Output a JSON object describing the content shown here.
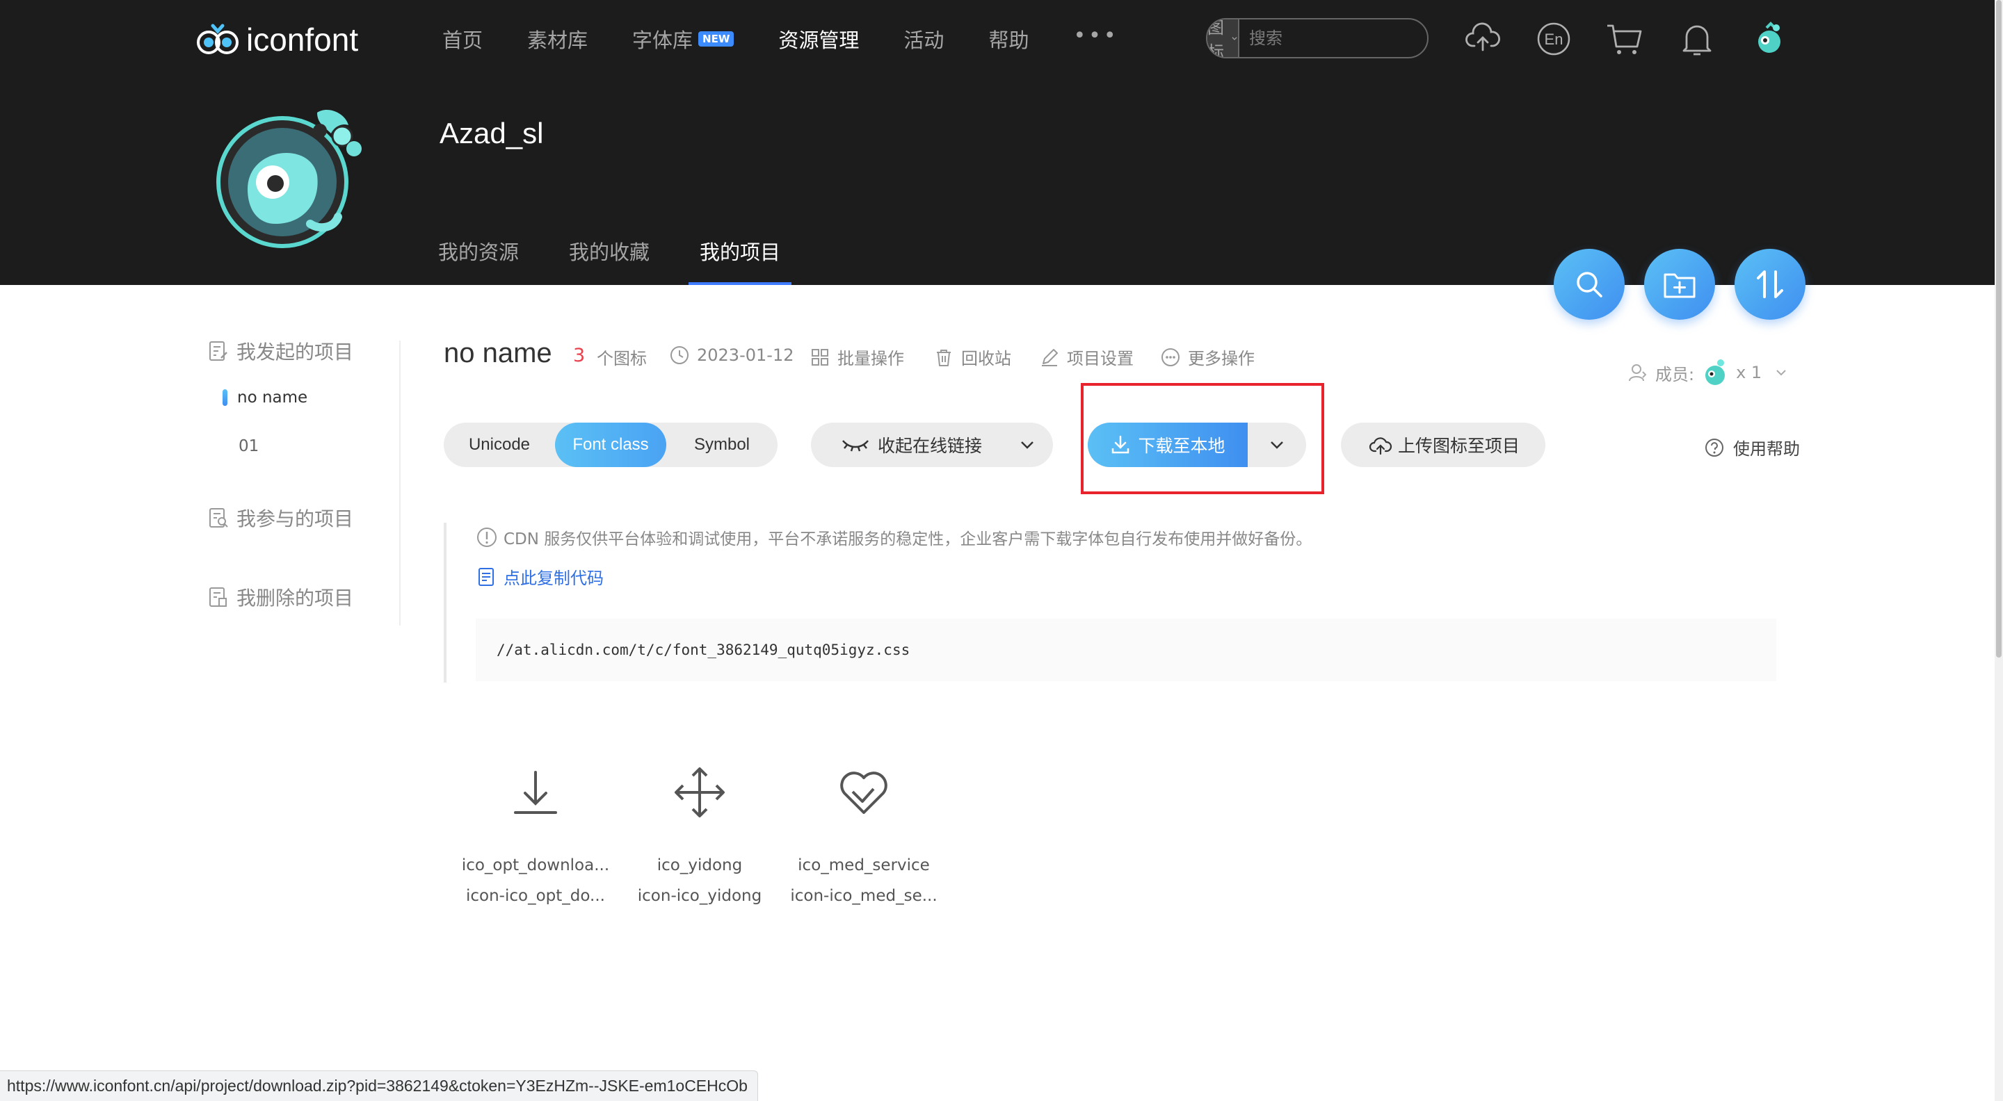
{
  "header": {
    "logo_text": "iconfont",
    "nav": [
      {
        "label": "首页"
      },
      {
        "label": "素材库"
      },
      {
        "label": "字体库",
        "badge": "NEW"
      },
      {
        "label": "资源管理",
        "active": true
      },
      {
        "label": "活动"
      },
      {
        "label": "帮助"
      }
    ],
    "more": "•••",
    "search": {
      "type": "图标",
      "placeholder": "搜索"
    },
    "icons": [
      "upload-cloud-icon",
      "language-en-icon",
      "cart-icon",
      "bell-icon",
      "user-avatar"
    ],
    "lang_label": "En"
  },
  "profile": {
    "username": "Azad_sl",
    "tabs": [
      {
        "label": "我的资源"
      },
      {
        "label": "我的收藏"
      },
      {
        "label": "我的项目",
        "active": true
      }
    ]
  },
  "sidebar": {
    "groups": [
      {
        "label": "我发起的项目",
        "items": [
          {
            "label": "no name",
            "active": true
          },
          {
            "label": "01"
          }
        ]
      },
      {
        "label": "我参与的项目"
      },
      {
        "label": "我删除的项目"
      }
    ]
  },
  "project": {
    "title": "no name",
    "count": "3",
    "count_unit": "个图标",
    "date": "2023-01-12",
    "batch": "批量操作",
    "recycle": "回收站",
    "settings": "项目设置",
    "more": "更多操作",
    "members_label": "成员:",
    "members_count": "x 1"
  },
  "toolbar": {
    "tabs": [
      {
        "label": "Unicode"
      },
      {
        "label": "Font class",
        "active": true
      },
      {
        "label": "Symbol"
      }
    ],
    "collapse_link": "收起在线链接",
    "download": "下载至本地",
    "upload": "上传图标至项目",
    "help": "使用帮助"
  },
  "cdn": {
    "notice": "CDN 服务仅供平台体验和调试使用，平台不承诺服务的稳定性，企业客户需下载字体包自行发布使用并做好备份。",
    "copy": "点此复制代码",
    "url": "//at.alicdn.com/t/c/font_3862149_qutq05igyz.css"
  },
  "icons": [
    {
      "name": "ico_opt_downloa...",
      "class": "icon-ico_opt_do...",
      "glyph": "download-arrow-icon"
    },
    {
      "name": "ico_yidong",
      "class": "icon-ico_yidong",
      "glyph": "move-arrows-icon"
    },
    {
      "name": "ico_med_service",
      "class": "icon-ico_med_se...",
      "glyph": "heart-hand-icon"
    }
  ],
  "status_bar": {
    "url": "https://www.iconfont.cn/api/project/download.zip?pid=3862149&ctoken=Y3EzHZm--JSKE-em1oCEHcOb"
  },
  "colors": {
    "header_bg": "#1c1c1c",
    "accent_gradient_start": "#5bc0f5",
    "accent_gradient_end": "#3f8ff0",
    "highlight_box": "#e8232b",
    "count_red": "#e8424e",
    "link_blue": "#2f6fe4"
  }
}
